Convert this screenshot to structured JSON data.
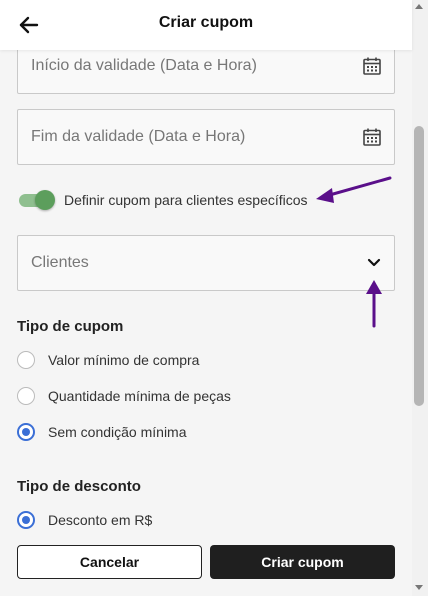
{
  "header": {
    "title": "Criar cupom",
    "back_icon": "arrow-left-icon"
  },
  "fields": {
    "start": {
      "placeholder": "Início da validade (Data e Hora)",
      "icon": "calendar-icon"
    },
    "end": {
      "placeholder": "Fim da validade (Data e Hora)",
      "icon": "calendar-icon"
    },
    "clients": {
      "placeholder": "Clientes",
      "icon": "chevron-down-icon"
    }
  },
  "toggle": {
    "label": "Definir cupom para clientes específicos",
    "on": true
  },
  "coupon_type": {
    "title": "Tipo de cupom",
    "options": [
      {
        "label": "Valor mínimo de compra",
        "checked": false
      },
      {
        "label": "Quantidade mínima de peças",
        "checked": false
      },
      {
        "label": "Sem condição mínima",
        "checked": true
      }
    ]
  },
  "discount_type": {
    "title": "Tipo de desconto",
    "options": [
      {
        "label": "Desconto em R$",
        "checked": true
      }
    ]
  },
  "footer": {
    "cancel_label": "Cancelar",
    "create_label": "Criar cupom"
  },
  "colors": {
    "accent": "#3b6fd6",
    "toggle": "#5c9e5c",
    "annotation": "#5a0f8a",
    "primary_button": "#1f1f1f"
  }
}
